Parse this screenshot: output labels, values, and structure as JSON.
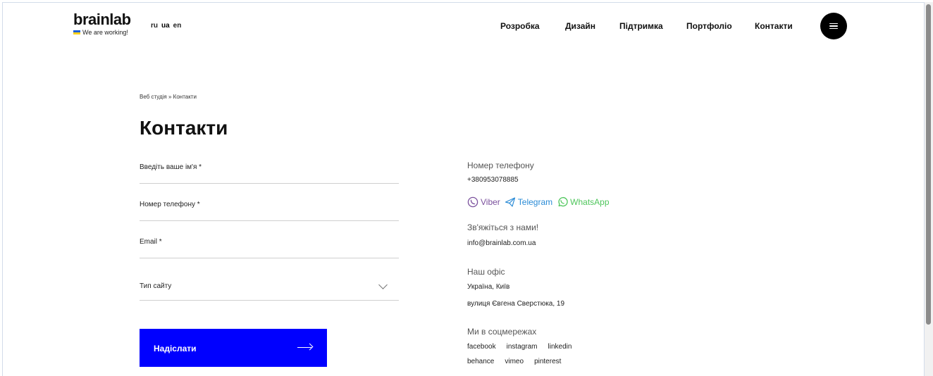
{
  "header": {
    "logo": "brainlab",
    "tagline": "We are working!",
    "languages": [
      "ru",
      "ua",
      "en"
    ],
    "nav": [
      "Розробка",
      "Дизайн",
      "Підтримка",
      "Портфоліо",
      "Контакти"
    ]
  },
  "breadcrumb": "Веб студія » Контакти",
  "page_title": "Контакти",
  "form": {
    "name_label": "Введіть ваше ім'я *",
    "phone_label": "Номер телефону *",
    "email_label": "Email *",
    "type_label": "Тип сайту",
    "submit_label": "Надіслати"
  },
  "contacts": {
    "phone_heading": "Номер телефону",
    "phone": "+380953078885",
    "messengers": [
      "Viber",
      "Telegram",
      "WhatsApp"
    ],
    "email_heading": "Зв'яжіться з нами!",
    "email": "info@brainlab.com.ua",
    "office_heading": "Наш офіс",
    "office_city": "Україна, Київ",
    "office_street": "вулиця Євгена Сверстюка, 19",
    "social_heading": "Ми в соцмережах",
    "social_row1": [
      "facebook",
      "instagram",
      "linkedin"
    ],
    "social_row2": [
      "behance",
      "vimeo",
      "pinterest"
    ]
  },
  "colors": {
    "accent": "#0000ff",
    "viber": "#7b519d",
    "telegram": "#2a8bd6",
    "whatsapp": "#4fc65c"
  }
}
